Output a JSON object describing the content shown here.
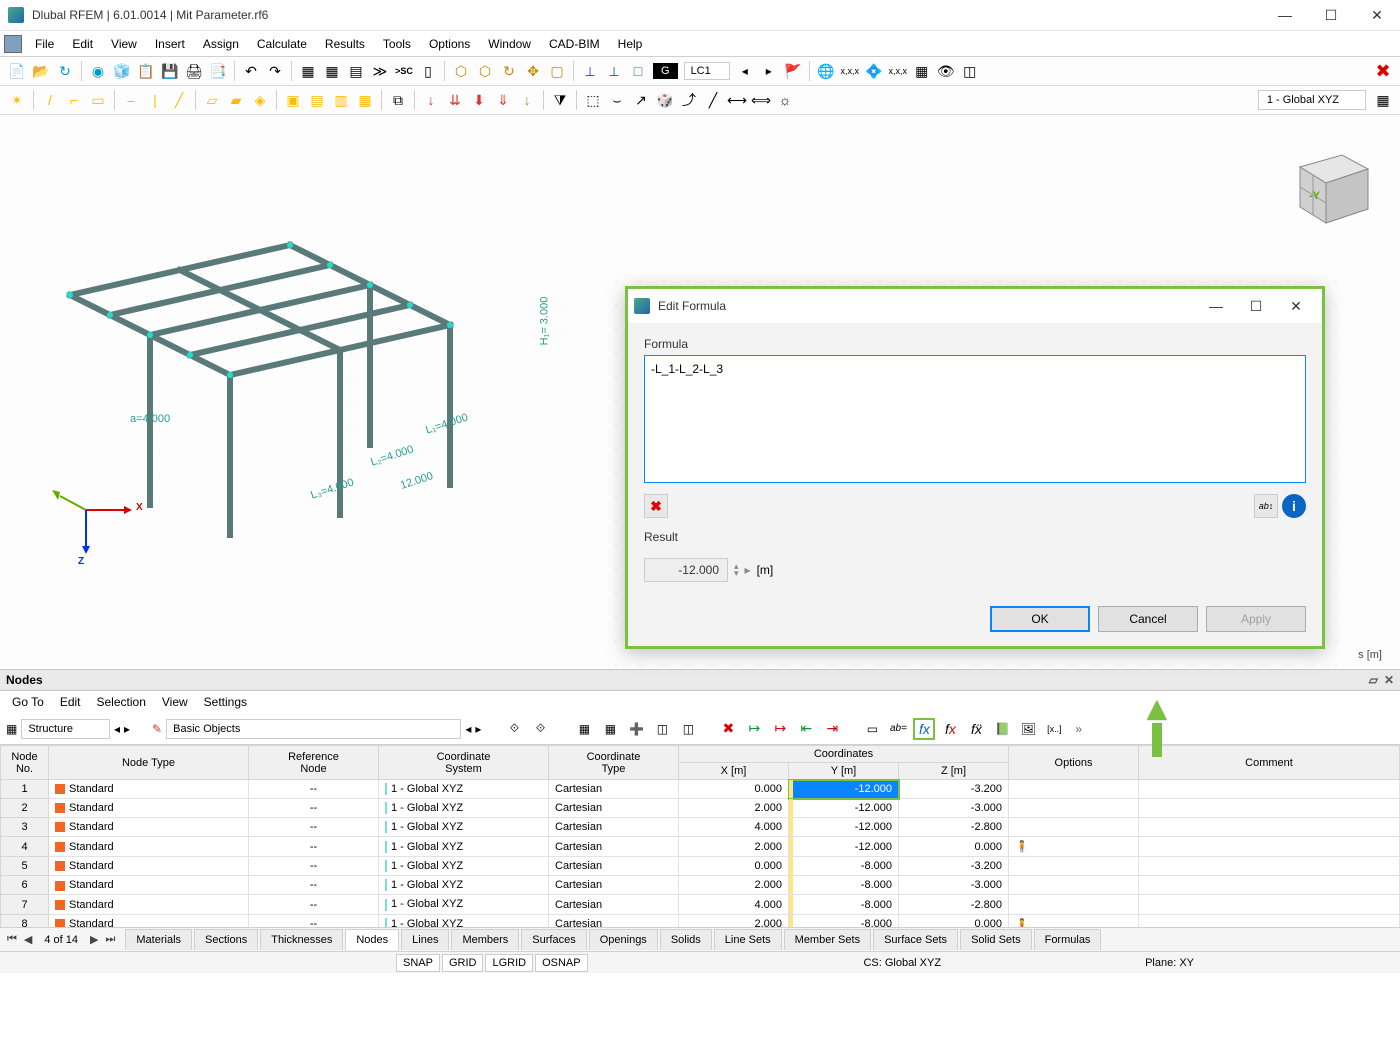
{
  "titlebar": {
    "title": "Dlubal RFEM | 6.01.0014 | Mit Parameter.rf6"
  },
  "menu": [
    "File",
    "Edit",
    "View",
    "Insert",
    "Assign",
    "Calculate",
    "Results",
    "Tools",
    "Options",
    "Window",
    "CAD-BIM",
    "Help"
  ],
  "loadcase": {
    "box": "G",
    "sel": "LC1"
  },
  "coord_system": "1 - Global XYZ",
  "viewport": {
    "dims": {
      "a": "a=4.000",
      "L1": "L₁=4.000",
      "L2": "L₂=4.000",
      "L3": "L₃=4.000",
      "Lsum": "12.000",
      "H1": "H₁= 3.000"
    },
    "axes": {
      "x": "X",
      "y": "Y",
      "z": "Z",
      "cube_y": "-Y"
    },
    "unit": "s [m]"
  },
  "nodes_panel": {
    "title": "Nodes",
    "menu": [
      "Go To",
      "Edit",
      "Selection",
      "View",
      "Settings"
    ],
    "sel1": "Structure",
    "sel2": "Basic Objects",
    "headers": {
      "no": [
        "Node",
        "No."
      ],
      "type": "Node Type",
      "ref": [
        "Reference",
        "Node"
      ],
      "cs": [
        "Coordinate",
        "System"
      ],
      "ct": [
        "Coordinate",
        "Type"
      ],
      "coords": "Coordinates",
      "x": "X [m]",
      "y": "Y [m]",
      "z": "Z [m]",
      "opt": "Options",
      "com": "Comment"
    },
    "rows": [
      {
        "no": "1",
        "type": "Standard",
        "ref": "--",
        "cs": "1 - Global XYZ",
        "ct": "Cartesian",
        "x": "0.000",
        "y": "-12.000",
        "z": "-3.200",
        "sel": true
      },
      {
        "no": "2",
        "type": "Standard",
        "ref": "--",
        "cs": "1 - Global XYZ",
        "ct": "Cartesian",
        "x": "2.000",
        "y": "-12.000",
        "z": "-3.000"
      },
      {
        "no": "3",
        "type": "Standard",
        "ref": "--",
        "cs": "1 - Global XYZ",
        "ct": "Cartesian",
        "x": "4.000",
        "y": "-12.000",
        "z": "-2.800"
      },
      {
        "no": "4",
        "type": "Standard",
        "ref": "--",
        "cs": "1 - Global XYZ",
        "ct": "Cartesian",
        "x": "2.000",
        "y": "-12.000",
        "z": "0.000",
        "opt": "🧍"
      },
      {
        "no": "5",
        "type": "Standard",
        "ref": "--",
        "cs": "1 - Global XYZ",
        "ct": "Cartesian",
        "x": "0.000",
        "y": "-8.000",
        "z": "-3.200"
      },
      {
        "no": "6",
        "type": "Standard",
        "ref": "--",
        "cs": "1 - Global XYZ",
        "ct": "Cartesian",
        "x": "2.000",
        "y": "-8.000",
        "z": "-3.000"
      },
      {
        "no": "7",
        "type": "Standard",
        "ref": "--",
        "cs": "1 - Global XYZ",
        "ct": "Cartesian",
        "x": "4.000",
        "y": "-8.000",
        "z": "-2.800"
      },
      {
        "no": "8",
        "type": "Standard",
        "ref": "--",
        "cs": "1 - Global XYZ",
        "ct": "Cartesian",
        "x": "2.000",
        "y": "-8.000",
        "z": "0.000",
        "opt": "🧍"
      }
    ]
  },
  "tabs": {
    "counter": "4 of 14",
    "list": [
      "Materials",
      "Sections",
      "Thicknesses",
      "Nodes",
      "Lines",
      "Members",
      "Surfaces",
      "Openings",
      "Solids",
      "Line Sets",
      "Member Sets",
      "Surface Sets",
      "Solid Sets",
      "Formulas"
    ],
    "active": "Nodes"
  },
  "status": {
    "snaps": [
      "SNAP",
      "GRID",
      "LGRID",
      "OSNAP"
    ],
    "cs": "CS: Global XYZ",
    "plane": "Plane: XY"
  },
  "dialog": {
    "title": "Edit Formula",
    "formula_label": "Formula",
    "formula": "-L_1-L_2-L_3",
    "result_label": "Result",
    "result": "-12.000",
    "unit": "[m]",
    "buttons": {
      "ok": "OK",
      "cancel": "Cancel",
      "apply": "Apply"
    }
  }
}
